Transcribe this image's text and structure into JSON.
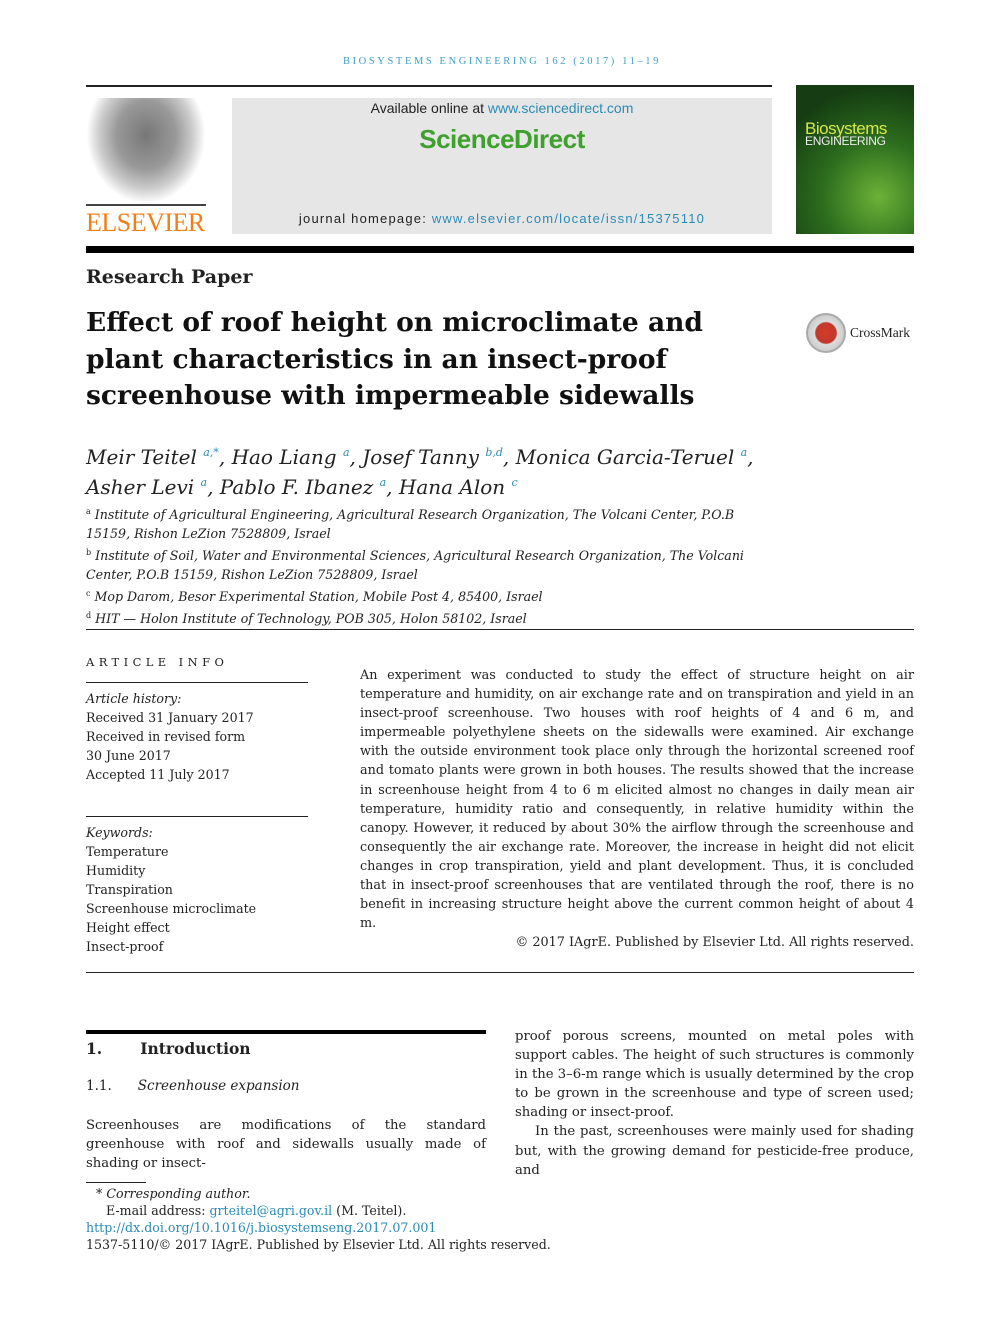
{
  "header": {
    "running_head": "BIOSYSTEMS ENGINEERING 162 (2017) 11–19",
    "publisher_logo": "ELSEVIER",
    "available_online_prefix": "Available online at ",
    "available_online_link": "www.sciencedirect.com",
    "sciencedirect": "ScienceDirect",
    "homepage_prefix": "journal homepage: ",
    "homepage_link": "www.elsevier.com/locate/issn/15375110",
    "cover_title_1": "Biosystems",
    "cover_title_2": "ENGINEERING"
  },
  "article": {
    "type": "Research Paper",
    "title": "Effect of roof height on microclimate and plant characteristics in an insect-proof screenhouse with impermeable sidewalls",
    "crossmark": "CrossMark",
    "authors": [
      {
        "name": "Meir Teitel",
        "sup": "a,*",
        "sep": ", "
      },
      {
        "name": "Hao Liang",
        "sup": "a",
        "sep": ", "
      },
      {
        "name": "Josef Tanny",
        "sup": "b,d",
        "sep": ", "
      },
      {
        "name": "Monica Garcia-Teruel",
        "sup": "a",
        "sep": ","
      },
      {
        "name": "Asher Levi",
        "sup": "a",
        "sep": ", "
      },
      {
        "name": "Pablo F. Ibanez",
        "sup": "a",
        "sep": ", "
      },
      {
        "name": "Hana Alon",
        "sup": "c",
        "sep": ""
      }
    ],
    "affiliations": [
      {
        "sup": "a",
        "text": "Institute of Agricultural Engineering, Agricultural Research Organization, The Volcani Center, P.O.B 15159, Rishon LeZion 7528809, Israel"
      },
      {
        "sup": "b",
        "text": "Institute of Soil, Water and Environmental Sciences, Agricultural Research Organization, The Volcani Center, P.O.B 15159, Rishon LeZion 7528809, Israel"
      },
      {
        "sup": "c",
        "text": "Mop Darom, Besor Experimental Station, Mobile Post 4, 85400, Israel"
      },
      {
        "sup": "d",
        "text": "HIT — Holon Institute of Technology, POB 305, Holon 58102, Israel"
      }
    ]
  },
  "article_info": {
    "heading": "ARTICLE INFO",
    "history_label": "Article history:",
    "history": [
      "Received 31 January 2017",
      "Received in revised form",
      "30 June 2017",
      "Accepted 11 July 2017"
    ],
    "keywords_label": "Keywords:",
    "keywords": [
      "Temperature",
      "Humidity",
      "Transpiration",
      "Screenhouse microclimate",
      "Height effect",
      "Insect-proof"
    ]
  },
  "abstract": {
    "text": "An experiment was conducted to study the effect of structure height on air temperature and humidity, on air exchange rate and on transpiration and yield in an insect-proof screenhouse. Two houses with roof heights of 4 and 6 m, and impermeable polyethylene sheets on the sidewalls were examined. Air exchange with the outside environment took place only through the horizontal screened roof and tomato plants were grown in both houses. The results showed that the increase in screenhouse height from 4 to 6 m elicited almost no changes in daily mean air temperature, humidity ratio and consequently, in relative humidity within the canopy. However, it reduced by about 30% the airflow through the screenhouse and consequently the air exchange rate. Moreover, the increase in height did not elicit changes in crop transpiration, yield and plant development. Thus, it is concluded that in insect-proof screenhouses that are ventilated through the roof, there is no benefit in increasing structure height above the current common height of about 4 m.",
    "copyright": "© 2017 IAgrE. Published by Elsevier Ltd. All rights reserved."
  },
  "body": {
    "section_number": "1.",
    "section_title": "Introduction",
    "subsection_number": "1.1.",
    "subsection_title": "Screenhouse expansion",
    "col1_para": "Screenhouses are modifications of the standard greenhouse with roof and sidewalls usually made of shading or insect-",
    "col2_para1": "proof porous screens, mounted on metal poles with support cables. The height of such structures is commonly in the 3–6-m range which is usually determined by the crop to be grown in the screenhouse and type of screen used; shading or insect-proof.",
    "col2_para2": "In the past, screenhouses were mainly used for shading but, with the growing demand for pesticide-free produce, and"
  },
  "footnotes": {
    "corresponding_mark": "*",
    "corresponding": "Corresponding author.",
    "email_label": "E-mail address: ",
    "email": "grteitel@agri.gov.il",
    "email_suffix": " (M. Teitel).",
    "doi": "http://dx.doi.org/10.1016/j.biosystemseng.2017.07.001",
    "issn_line": "1537-5110/© 2017 IAgrE. Published by Elsevier Ltd. All rights reserved."
  },
  "colors": {
    "link": "#2a8bb5",
    "elsevier_orange": "#f07f1a",
    "sciencedirect_green": "#3ea02d",
    "running_head": "#3c9fc7"
  }
}
